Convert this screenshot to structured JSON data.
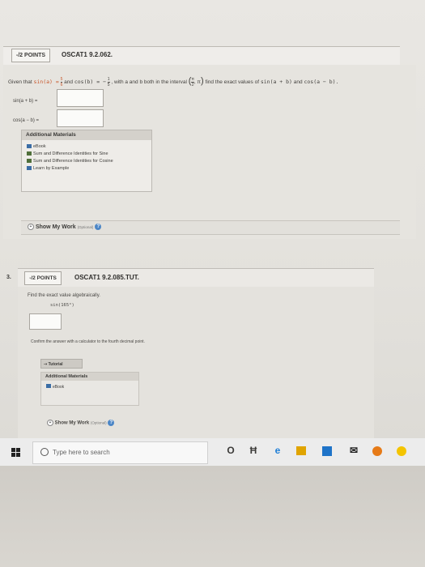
{
  "q1": {
    "points": "-/2 POINTS",
    "id": "OSCAT1 9.2.062.",
    "given_prefix": "Given that",
    "sin_a_label": "sin(a) =",
    "sin_a_num": "5",
    "sin_a_den": "6",
    "and": "and",
    "cos_b_label": "cos(b) = −",
    "cos_b_num": "1",
    "cos_b_den": "5",
    "interval_text": ", with a and b both in the interval",
    "interval_num": "π",
    "interval_den": "2",
    "interval_end": ", π",
    "find_text": "find the exact values of",
    "target1": "sin(a + b)",
    "target2": "cos(a − b).",
    "ans1_label": "sin(a + b) =",
    "ans2_label": "cos(a − b) =",
    "additional_materials": "Additional Materials",
    "materials": [
      "eBook",
      "Sum and Difference Identities for Sine",
      "Sum and Difference Identities for Cosine",
      "Learn by Example"
    ],
    "show_work": "Show My Work",
    "optional": "(Optional)"
  },
  "q3": {
    "number": "3.",
    "points": "-/2 POINTS",
    "id": "OSCAT1 9.2.085.TUT.",
    "prompt": "Find the exact value algebraically.",
    "expr": "sin(165°)",
    "confirm": "Confirm the answer with a calculator to the fourth decimal point.",
    "tutorial": "Tutorial",
    "additional_materials": "Additional Materials",
    "ebook": "eBook",
    "show_work": "Show My Work",
    "optional": "(Optional)"
  },
  "taskbar": {
    "search_placeholder": "Type here to search",
    "cortana_icon": "O",
    "taskview_icon": "Ħ"
  }
}
